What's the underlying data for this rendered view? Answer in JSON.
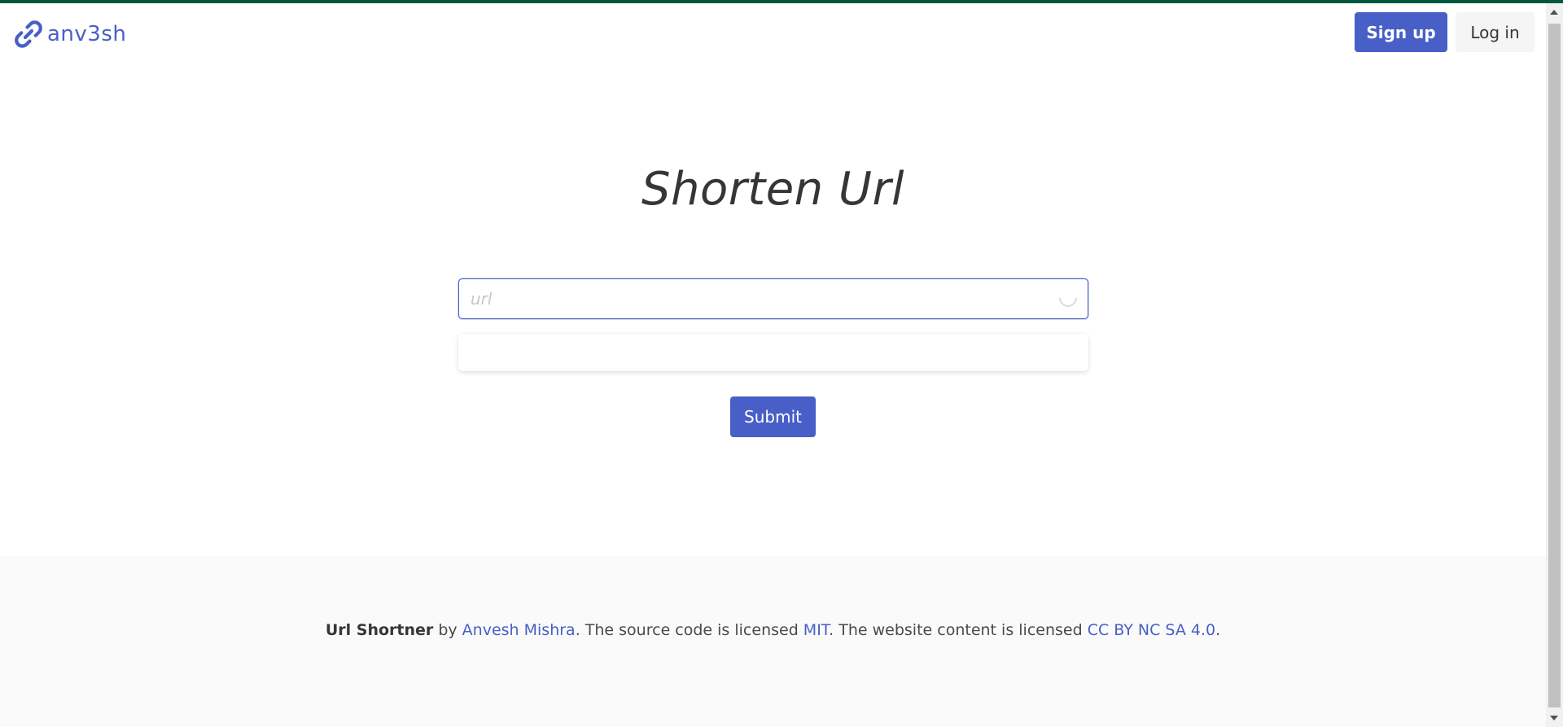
{
  "brand": {
    "name": "anv3sh",
    "icon": "link-icon",
    "color": "#485fc7"
  },
  "nav": {
    "signup_label": "Sign up",
    "login_label": "Log in"
  },
  "hero": {
    "title": "Shorten Url",
    "input": {
      "placeholder": "url",
      "value": ""
    },
    "submit_label": "Submit"
  },
  "footer": {
    "project": "Url Shortner",
    "by": " by ",
    "author": "Anvesh Mishra",
    "source_text": ". The source code is licensed ",
    "source_license": "MIT",
    "content_text": ". The website content is licensed ",
    "content_license": "CC BY NC SA 4.0",
    "end": "."
  },
  "colors": {
    "accent": "#485fc7",
    "top_bar": "#00583f",
    "footer_bg": "#fafafa"
  }
}
